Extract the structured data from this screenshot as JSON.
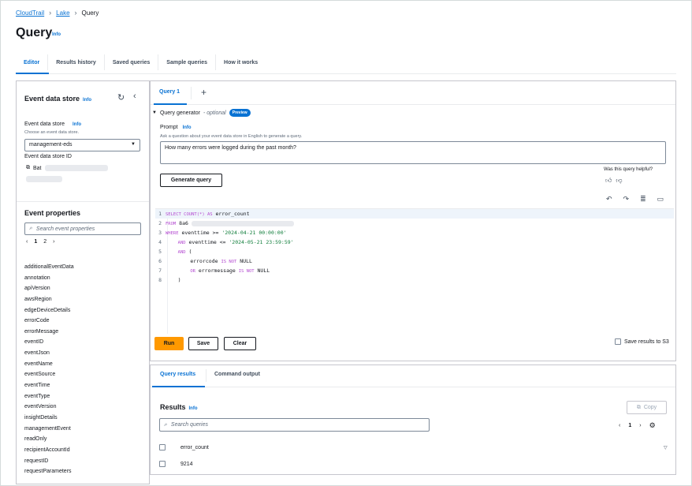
{
  "breadcrumb": {
    "items": [
      "CloudTrail",
      "Lake",
      "Query"
    ]
  },
  "page": {
    "title": "Query",
    "info": "Info"
  },
  "tabs": [
    "Editor",
    "Results history",
    "Saved queries",
    "Sample queries",
    "How it works"
  ],
  "left": {
    "title": "Event data store",
    "info": "Info",
    "field_label": "Event data store",
    "field_info": "Info",
    "field_desc": "Choose an event data store.",
    "selected": "management-eds",
    "id_label": "Event data store ID",
    "id_value_prefix": "Bat",
    "props_title": "Event properties",
    "search_placeholder": "Search event properties",
    "pages": [
      "1",
      "2"
    ],
    "properties": [
      "additionalEventData",
      "annotation",
      "apiVersion",
      "awsRegion",
      "edgeDeviceDetails",
      "errorCode",
      "errorMessage",
      "eventID",
      "eventJson",
      "eventName",
      "eventSource",
      "eventTime",
      "eventType",
      "eventVersion",
      "insightDetails",
      "managementEvent",
      "readOnly",
      "recipientAccountId",
      "requestID",
      "requestParameters"
    ]
  },
  "editor": {
    "tab": "Query 1",
    "plus": "+",
    "generator_label": "Query generator",
    "generator_optional": "- optional",
    "preview": "Preview",
    "prompt_label": "Prompt",
    "prompt_info": "Info",
    "prompt_desc": "Ask a question about your event data store in English to generate a query.",
    "prompt_value": "How many errors were logged during the past month?",
    "helpful": "Was this query helpful?",
    "generate": "Generate query",
    "code_lines": [
      {
        "n": "1",
        "k1": "SELECT COUNT(*) AS",
        "t1": " error_count"
      },
      {
        "n": "2",
        "k1": "FROM",
        "t1": " 8a6"
      },
      {
        "n": "3",
        "k1": "WHERE",
        "t1": " eventtime >= ",
        "s1": "'2024-04-21 00:00:00'"
      },
      {
        "n": "4",
        "pre": "    ",
        "k1": "AND",
        "t1": " eventtime <= ",
        "s1": "'2024-05-21 23:59:59'"
      },
      {
        "n": "5",
        "pre": "    ",
        "k1": "AND",
        "t1": " ("
      },
      {
        "n": "6",
        "pre": "        ",
        "t0": "errorcode ",
        "k1": "IS NOT",
        "t1": " NULL"
      },
      {
        "n": "7",
        "pre": "        ",
        "k1": "OR",
        "t1": " errormessage ",
        "k2": "IS NOT",
        "t2": " NULL"
      },
      {
        "n": "8",
        "pre": "    ",
        "t1": ")"
      }
    ],
    "run": "Run",
    "save": "Save",
    "clear": "Clear",
    "save_s3": "Save results to S3"
  },
  "results": {
    "tab_results": "Query results",
    "tab_output": "Command output",
    "title": "Results",
    "info": "Info",
    "copy": "Copy",
    "search_placeholder": "Search queries",
    "page": "1",
    "column": "error_count",
    "rows": [
      "9214"
    ]
  }
}
